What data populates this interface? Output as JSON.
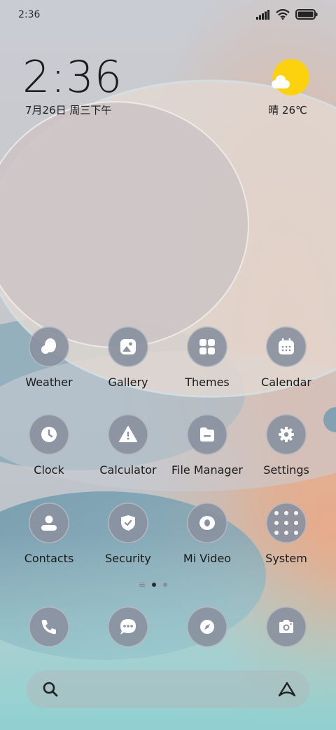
{
  "status_bar": {
    "time": "2:36"
  },
  "lockclock": {
    "time": "2:36",
    "date": "7月26日 周三下午"
  },
  "weather": {
    "text": "晴 26℃",
    "sun_color": "#fcd20e"
  },
  "apps": [
    {
      "label": "Weather",
      "icon": "weather-icon"
    },
    {
      "label": "Gallery",
      "icon": "gallery-icon"
    },
    {
      "label": "Themes",
      "icon": "themes-icon"
    },
    {
      "label": "Calendar",
      "icon": "calendar-icon"
    },
    {
      "label": "Clock",
      "icon": "clock-icon"
    },
    {
      "label": "Calculator",
      "icon": "calculator-icon"
    },
    {
      "label": "File Manager",
      "icon": "file-manager-icon"
    },
    {
      "label": "Settings",
      "icon": "settings-icon"
    },
    {
      "label": "Contacts",
      "icon": "contacts-icon"
    },
    {
      "label": "Security",
      "icon": "security-icon"
    },
    {
      "label": "Mi Video",
      "icon": "mi-video-icon"
    },
    {
      "label": "System",
      "icon": "system-folder-icon"
    }
  ],
  "page_indicator": {
    "pages": 2,
    "current": 1
  },
  "dock": [
    {
      "icon": "phone-icon"
    },
    {
      "icon": "messages-icon"
    },
    {
      "icon": "browser-icon"
    },
    {
      "icon": "camera-icon"
    }
  ],
  "search": {
    "icon": "search-icon",
    "assistant_icon": "assistant-icon"
  },
  "colors": {
    "icon_bg": "#8a91a0",
    "text": "#1a1a1a"
  }
}
